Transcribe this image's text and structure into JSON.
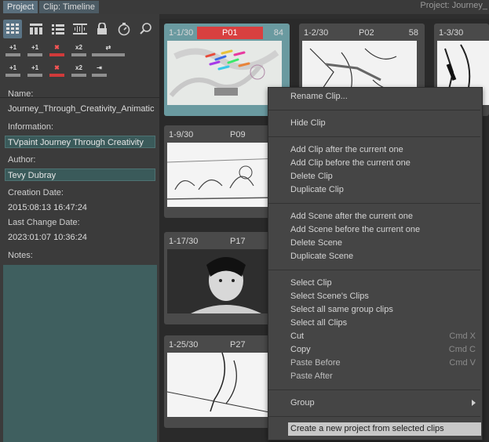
{
  "tabs": {
    "project": "Project",
    "clip": "Clip: Timeline"
  },
  "window_title": "Project: Journey_",
  "toolbar": {
    "icons": [
      "grid-view-icon",
      "film-view-icon",
      "list-view-icon",
      "waveform-icon",
      "lock-icon",
      "timer-icon",
      "search-icon"
    ]
  },
  "mini_buttons": {
    "row1": [
      "+1",
      "+1",
      "✖",
      "x2",
      "⇄"
    ],
    "row2": [
      "+1",
      "+1",
      "✖",
      "x2",
      "⇥"
    ]
  },
  "fields": {
    "name_label": "Name:",
    "name_value": "Journey_Through_Creativity_Animatic",
    "information_label": "Information:",
    "information_value": "TVpaint Journey Through Creativity",
    "author_label": "Author:",
    "author_value": "Tevy Dubray",
    "creation_label": "Creation Date:",
    "creation_value": "2015:08:13 16:47:24",
    "change_label": "Last Change Date:",
    "change_value": "2023:01:07 10:36:24",
    "notes_label": "Notes:"
  },
  "clips": [
    {
      "id": "1-1/30",
      "name": "P01",
      "frames": "84"
    },
    {
      "id": "1-2/30",
      "name": "P02",
      "frames": "58"
    },
    {
      "id": "1-3/30",
      "name": "",
      "frames": ""
    },
    {
      "id": "1-9/30",
      "name": "P09",
      "frames": ""
    },
    {
      "id": "1-17/30",
      "name": "P17",
      "frames": ""
    },
    {
      "id": "1-25/30",
      "name": "P27",
      "frames": ""
    }
  ],
  "menu": {
    "rename": "Rename Clip...",
    "hide": "Hide Clip",
    "add_after": "Add Clip after the current one",
    "add_before": "Add Clip before the current one",
    "delete": "Delete Clip",
    "duplicate": "Duplicate Clip",
    "scene_after": "Add Scene after the current one",
    "scene_before": "Add Scene before the current one",
    "scene_delete": "Delete Scene",
    "scene_duplicate": "Duplicate Scene",
    "select_clip": "Select Clip",
    "select_scene_clips": "Select Scene's Clips",
    "select_group": "Select all same group clips",
    "select_all": "Select all Clips",
    "cut": "Cut",
    "cut_sc": "Cmd X",
    "copy": "Copy",
    "copy_sc": "Cmd C",
    "paste_before": "Paste Before",
    "paste_before_sc": "Cmd V",
    "paste_after": "Paste After",
    "group": "Group",
    "create_project": "Create a new project from selected clips"
  },
  "colors": {
    "accent": "#5a7486",
    "selected_bar": "#d84040",
    "field_bg": "#3a5a5a"
  }
}
